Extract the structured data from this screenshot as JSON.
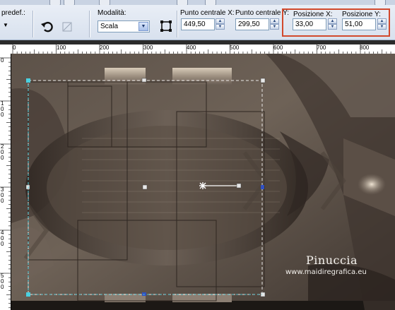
{
  "toolbar": {
    "preset_label": "predef.:",
    "mode": {
      "label": "Modalità:",
      "value": "Scala"
    },
    "center_x": {
      "label": "Punto centrale X:",
      "value": "449,50"
    },
    "center_y": {
      "label": "Punto centrale Y:",
      "value": "299,50"
    },
    "position_x": {
      "label": "Posizione X:",
      "value": "33,00"
    },
    "position_y": {
      "label": "Posizione Y:",
      "value": "51,00"
    },
    "highlight_color": "#d2492d"
  },
  "ruler": {
    "h_labels": [
      "0",
      "100",
      "200",
      "300",
      "400",
      "500",
      "600",
      "700",
      "800"
    ],
    "v_labels": [
      "0",
      "100",
      "200",
      "300",
      "400",
      "500"
    ]
  },
  "watermark": {
    "title": "Pinuccia",
    "url": "www.maidiregrafica.eu"
  },
  "colors": {
    "selection": "#4ad0e0",
    "image_dark": "#3a312b",
    "image_light": "#cdbfae"
  }
}
